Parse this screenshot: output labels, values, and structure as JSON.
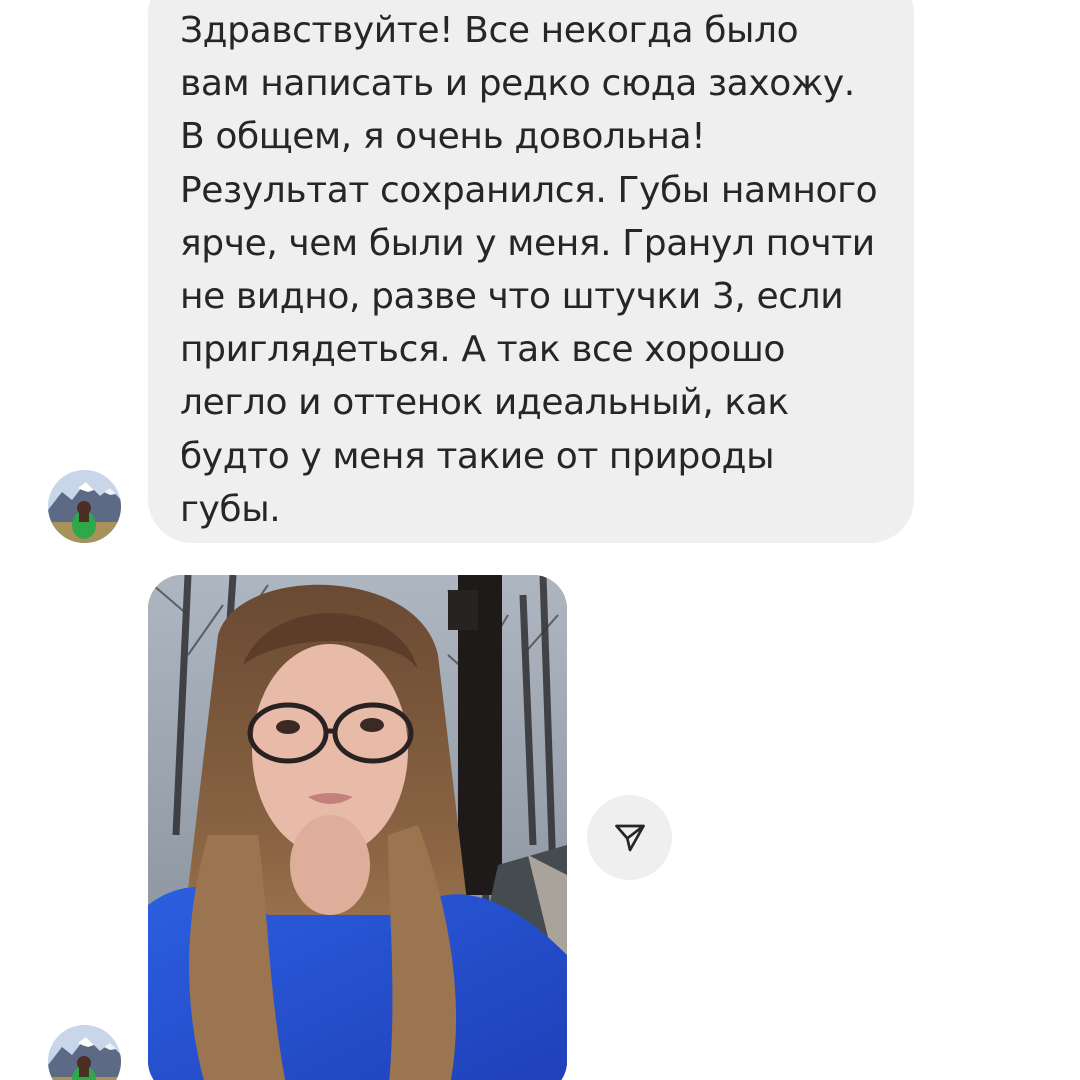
{
  "thread": {
    "incoming_message": {
      "text": "Здравствуйте! Все некогда было\nвам написать и редко сюда захожу.\nВ общем, я очень довольна!\nРезультат сохранился. Губы намного\nярче, чем были у меня. Гранул почти\nне видно, разве что штучки 3, если\nприглядеться. А так все хорошо\nлегло и оттенок идеальный, как\nбудто у меня такие от природы\nгубы."
    },
    "bubble_color": "#efefef",
    "text_color": "#262626",
    "share_icon": "send-icon"
  }
}
